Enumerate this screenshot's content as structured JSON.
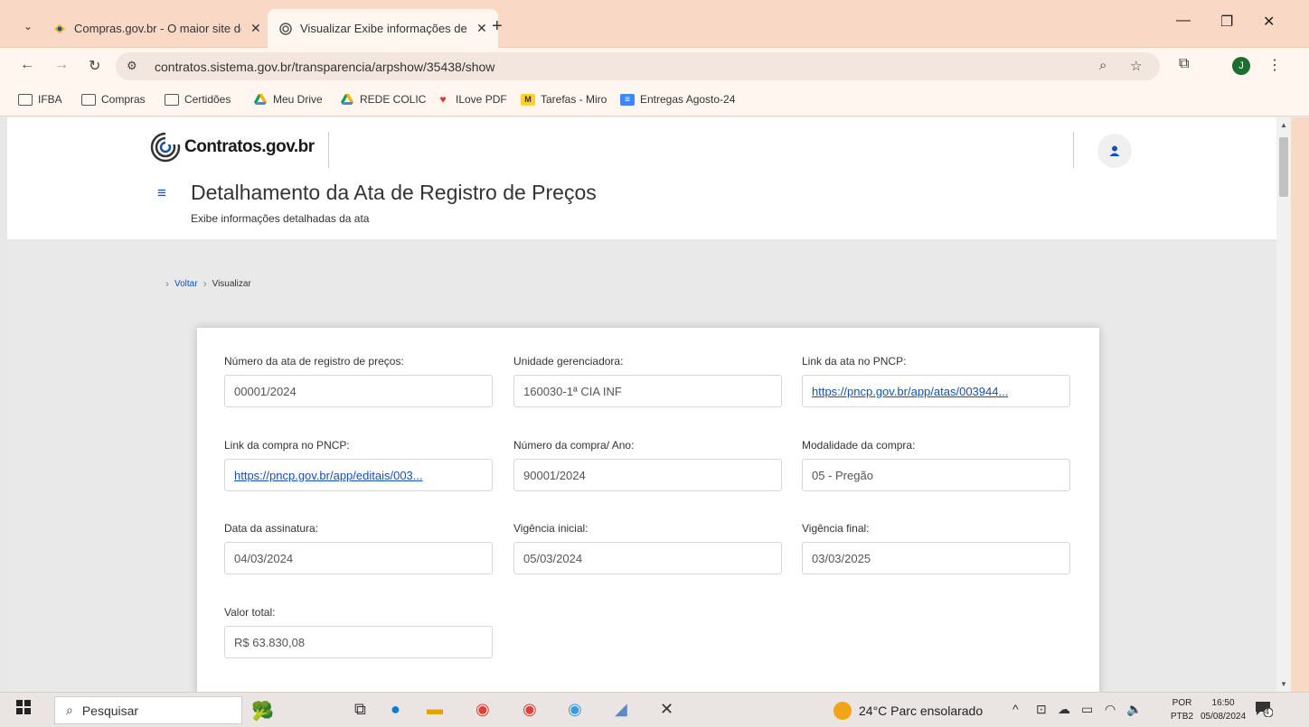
{
  "browser": {
    "tabs": [
      {
        "title": "Compras.gov.br - O maior site de",
        "active": false
      },
      {
        "title": "Visualizar Exibe informações de",
        "active": true
      }
    ],
    "new_tab": "+",
    "address": "contratos.sistema.gov.br/transparencia/arpshow/35438/show",
    "profile_initial": "J",
    "bookmarks": [
      "IFBA",
      "Compras",
      "Certidões",
      "Meu Drive",
      "REDE COLIC",
      "ILove PDF",
      "Tarefas - Miro",
      "Entregas Agosto-24"
    ]
  },
  "header": {
    "logo_text": "Contratos.gov.br",
    "title": "Detalhamento da Ata de Registro de Preços",
    "subtitle": "Exibe informações detalhadas da ata"
  },
  "breadcrumb": {
    "back": "Voltar",
    "current": "Visualizar"
  },
  "fields": {
    "numero_ata": {
      "label": "Número da ata de registro de preços:",
      "value": "00001/2024"
    },
    "unidade": {
      "label": "Unidade gerenciadora:",
      "value": "160030-1ª CIA INF"
    },
    "link_ata": {
      "label": "Link da ata no PNCP:",
      "value": "https://pncp.gov.br/app/atas/003944..."
    },
    "link_compra": {
      "label": "Link da compra no PNCP:",
      "value": "https://pncp.gov.br/app/editais/003..."
    },
    "numero_compra": {
      "label": "Número da compra/ Ano:",
      "value": "90001/2024"
    },
    "modalidade": {
      "label": "Modalidade da compra:",
      "value": "05 - Pregão"
    },
    "data_assinatura": {
      "label": "Data da assinatura:",
      "value": "04/03/2024"
    },
    "vigencia_inicial": {
      "label": "Vigência inicial:",
      "value": "05/03/2024"
    },
    "vigencia_final": {
      "label": "Vigência final:",
      "value": "03/03/2025"
    },
    "valor_total": {
      "label": "Valor total:",
      "value": "R$ 63.830,08"
    }
  },
  "taskbar": {
    "search_placeholder": "Pesquisar",
    "weather": "24°C  Parc ensolarado",
    "lang1": "POR",
    "lang2": "PTB2",
    "time": "16:50",
    "date": "05/08/2024",
    "notif_count": "4"
  },
  "colors": {
    "accent": "#1351b4",
    "tabbar": "#f9d9c6"
  }
}
